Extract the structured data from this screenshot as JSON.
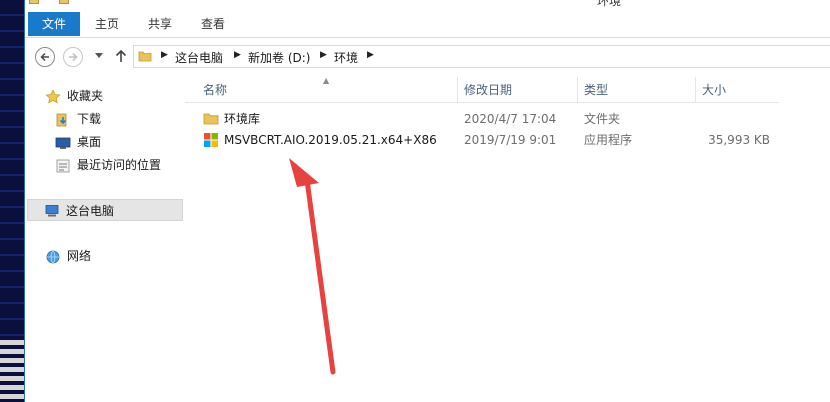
{
  "window": {
    "title": "环境"
  },
  "ribbon": {
    "tabs": [
      {
        "label": "文件"
      },
      {
        "label": "主页"
      },
      {
        "label": "共享"
      },
      {
        "label": "查看"
      }
    ]
  },
  "address": {
    "crumbs": [
      "这台电脑",
      "新加卷 (D:)",
      "环境"
    ]
  },
  "nav": {
    "favorites": "收藏夹",
    "downloads": "下载",
    "desktop": "桌面",
    "recent": "最近访问的位置",
    "this_pc": "这台电脑",
    "network": "网络"
  },
  "columns": {
    "name": "名称",
    "modified": "修改日期",
    "type": "类型",
    "size": "大小"
  },
  "files": [
    {
      "name": "环境库",
      "modified": "2020/4/7 17:04",
      "type": "文件夹",
      "size": "",
      "icon": "folder-icon"
    },
    {
      "name": "MSVBCRT.AIO.2019.05.21.x64+X86",
      "modified": "2019/7/19 9:01",
      "type": "应用程序",
      "size": "35,993 KB",
      "icon": "app-icon"
    }
  ],
  "colors": {
    "file_tab": "#1979ca",
    "annotation_arrow": "#e8423e"
  }
}
